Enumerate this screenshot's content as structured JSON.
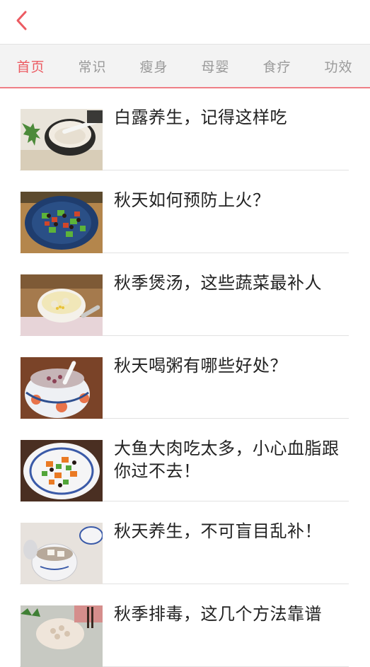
{
  "header": {
    "back_icon": "chevron-left-icon",
    "accent_color": "#ec5b62"
  },
  "tabs": [
    {
      "label": "首页",
      "active": true
    },
    {
      "label": "常识",
      "active": false
    },
    {
      "label": "瘦身",
      "active": false
    },
    {
      "label": "母婴",
      "active": false
    },
    {
      "label": "食疗",
      "active": false
    },
    {
      "label": "功效",
      "active": false
    }
  ],
  "articles": [
    {
      "title": "白露养生，记得这样吃",
      "image": "porridge-bowl-photo"
    },
    {
      "title": "秋天如何预防上火？",
      "image": "vegetable-plate-photo"
    },
    {
      "title": "秋季煲汤，这些蔬菜最补人",
      "image": "corn-soup-photo"
    },
    {
      "title": "秋天喝粥有哪些好处？",
      "image": "congee-bowl-photo"
    },
    {
      "title": "大鱼大肉吃太多，小心血脂跟你过不去！",
      "image": "stir-fry-plate-photo"
    },
    {
      "title": "秋天养生，不可盲目乱补！",
      "image": "stew-pot-photo"
    },
    {
      "title": "秋季排毒，这几个方法靠谱",
      "image": "lotus-root-photo"
    }
  ]
}
